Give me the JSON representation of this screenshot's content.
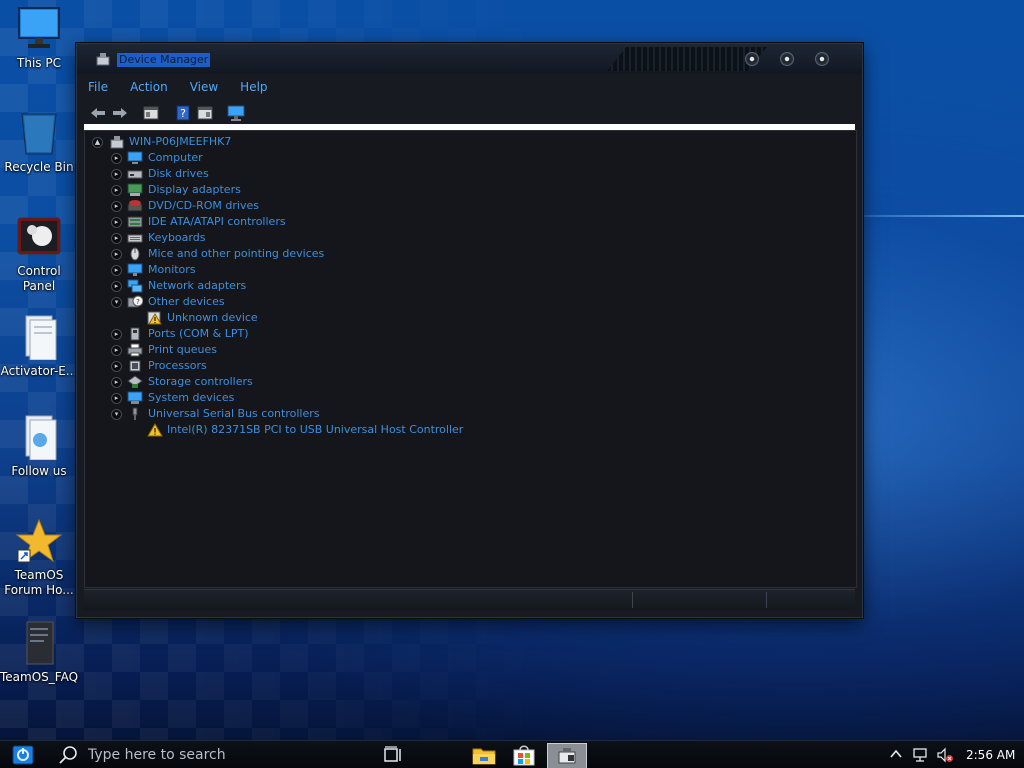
{
  "desktop": {
    "icons": [
      {
        "label": "This PC"
      },
      {
        "label": "Recycle Bin"
      },
      {
        "label": "Control Panel"
      },
      {
        "label": "Activator-E..."
      },
      {
        "label": "Follow us"
      },
      {
        "label": "TeamOS Forum Ho..."
      },
      {
        "label": "TeamOS_FAQ"
      }
    ]
  },
  "window": {
    "title": "Device Manager",
    "menu": [
      "File",
      "Action",
      "View",
      "Help"
    ],
    "toolbar_icons": [
      "back-arrow-icon",
      "forward-arrow-icon",
      "properties-icon",
      "help-icon",
      "console-tree-icon",
      "monitor-scan-icon"
    ],
    "tree": {
      "root": "WIN-P06JMEEFHK7",
      "items": [
        {
          "label": "Computer",
          "icon": "computer-icon",
          "expanded": false
        },
        {
          "label": "Disk drives",
          "icon": "disk-drive-icon",
          "expanded": false
        },
        {
          "label": "Display adapters",
          "icon": "display-adapter-icon",
          "expanded": false
        },
        {
          "label": "DVD/CD-ROM drives",
          "icon": "dvd-drive-icon",
          "expanded": false
        },
        {
          "label": "IDE ATA/ATAPI controllers",
          "icon": "ide-controller-icon",
          "expanded": false
        },
        {
          "label": "Keyboards",
          "icon": "keyboard-icon",
          "expanded": false
        },
        {
          "label": "Mice and other pointing devices",
          "icon": "mouse-icon",
          "expanded": false
        },
        {
          "label": "Monitors",
          "icon": "monitor-icon",
          "expanded": false
        },
        {
          "label": "Network adapters",
          "icon": "network-adapter-icon",
          "expanded": false
        },
        {
          "label": "Other devices",
          "icon": "other-devices-icon",
          "expanded": true,
          "children": [
            {
              "label": "Unknown device",
              "icon": "warning-device-icon"
            }
          ]
        },
        {
          "label": "Ports (COM & LPT)",
          "icon": "port-icon",
          "expanded": false
        },
        {
          "label": "Print queues",
          "icon": "printer-icon",
          "expanded": false
        },
        {
          "label": "Processors",
          "icon": "processor-icon",
          "expanded": false
        },
        {
          "label": "Storage controllers",
          "icon": "storage-controller-icon",
          "expanded": false
        },
        {
          "label": "System devices",
          "icon": "system-device-icon",
          "expanded": false
        },
        {
          "label": "Universal Serial Bus controllers",
          "icon": "usb-icon",
          "expanded": true,
          "children": [
            {
              "label": "Intel(R) 82371SB PCI to USB Universal Host Controller",
              "icon": "warning-icon"
            }
          ]
        }
      ]
    }
  },
  "taskbar": {
    "search_placeholder": "Type here to search",
    "clock": "2:56 AM",
    "apps": [
      "task-view-icon",
      "file-explorer-icon",
      "store-icon",
      "device-manager-app-icon"
    ],
    "tray": [
      "show-hidden-icons-chevron",
      "network-icon",
      "volume-muted-icon"
    ]
  },
  "colors": {
    "accent_text": "#3d8fe0",
    "window_bg": "#14161b",
    "desktop_blue": "#0b4ea3"
  }
}
